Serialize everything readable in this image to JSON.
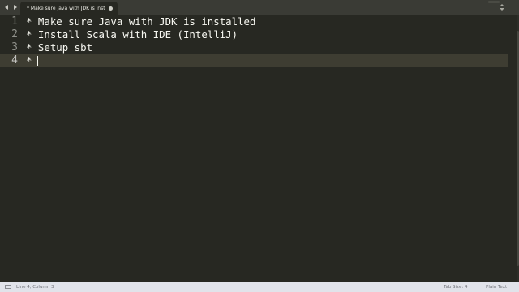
{
  "tab": {
    "label": "* Make sure Java with JDK is installed"
  },
  "lines": [
    {
      "number": "1",
      "text": "* Make sure Java with JDK is installed"
    },
    {
      "number": "2",
      "text": "* Install Scala with IDE (IntelliJ)"
    },
    {
      "number": "3",
      "text": "* Setup sbt"
    },
    {
      "number": "4",
      "text": "* "
    }
  ],
  "status": {
    "position": "Line 4, Column 3",
    "tab_size": "Tab Size: 4",
    "syntax": "Plain Text"
  },
  "icons": {
    "nav_back": "arrow-left-icon",
    "nav_forward": "arrow-right-icon",
    "tab_close": "close-dot-icon",
    "overflow": "tab-overflow-icon",
    "status_panel": "console-panel-icon"
  },
  "colors": {
    "editor_background": "#272822",
    "current_line": "#3e3d32",
    "text": "#f8f8f2",
    "gutter_text": "#8f908a",
    "status_bar": "#e1e3ea"
  }
}
